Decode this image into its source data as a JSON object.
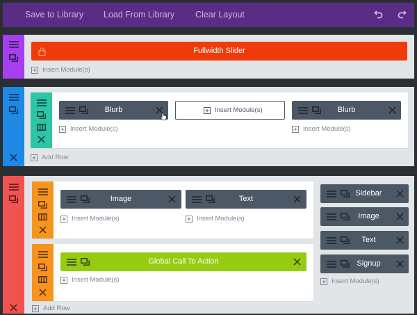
{
  "toolbar": {
    "save_label": "Save to Library",
    "load_label": "Load From Library",
    "clear_label": "Clear Layout",
    "undo_icon": "undo-icon",
    "redo_icon": "redo-icon"
  },
  "colors": {
    "toolbar_bg": "#5b2c86",
    "section1_handle": "#a63ef1",
    "section2_handle": "#1e88e5",
    "section3_handle": "#ef5350",
    "row_handle_teal": "#2ec4a6",
    "row_handle_orange": "#f7941e",
    "fullwidth_slider": "#ef3b0a",
    "global_module": "#95cc11",
    "module_dark": "#4c5866"
  },
  "insert_module_label": "Insert Module(s)",
  "add_row_label": "Add Row",
  "section1": {
    "module": "Fullwidth Slider"
  },
  "section2": {
    "modules": [
      "Blurb",
      "Insert Module(s)",
      "Blurb"
    ]
  },
  "section3": {
    "row1": [
      "Image",
      "Text"
    ],
    "row2": [
      "Global Call To Action"
    ],
    "sidebar": [
      "Sidebar",
      "Image",
      "Text",
      "Signup"
    ]
  }
}
